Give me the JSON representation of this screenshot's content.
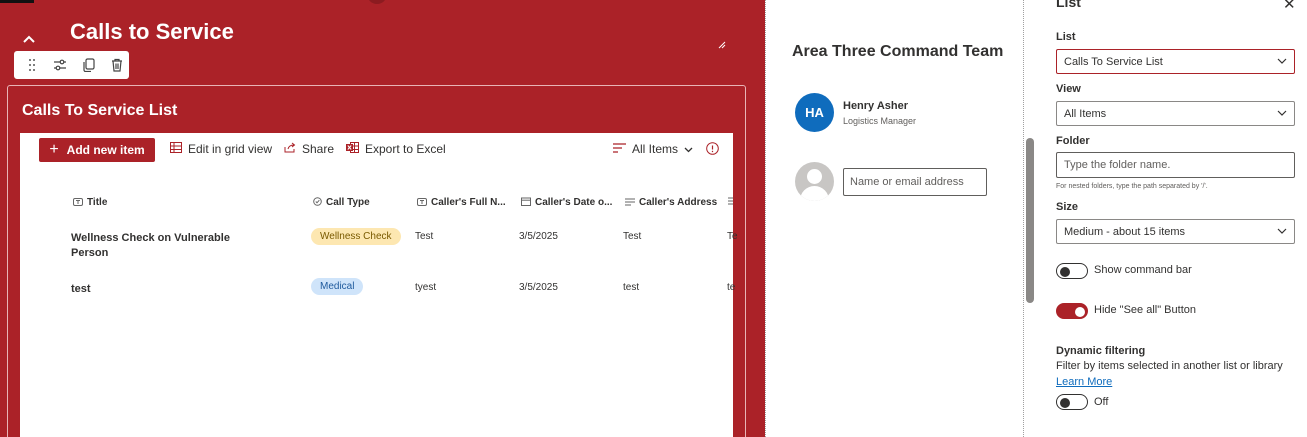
{
  "section": {
    "title": "Calls to Service",
    "collapse_icon": "chevron-up-icon",
    "resize_icon": "resize-handle-icon",
    "toolbar_icons": [
      "drag-handle-icon",
      "edit-properties-icon",
      "duplicate-icon",
      "delete-icon"
    ]
  },
  "list": {
    "title": "Calls To Service List",
    "commands": {
      "add_new": "Add new item",
      "grid_view": "Edit in grid view",
      "share": "Share",
      "export": "Export to Excel",
      "view": "All Items"
    },
    "columns": [
      "Title",
      "Call Type",
      "Caller's Full N...",
      "Caller's Date o...",
      "Caller's Address"
    ],
    "rows": [
      {
        "title": "Wellness Check on Vulnerable Person",
        "call_type": "Wellness Check",
        "full_name": "Test",
        "date": "3/5/2025",
        "address": "Test",
        "extra": "Te"
      },
      {
        "title": "test",
        "call_type": "Medical",
        "full_name": "tyest",
        "date": "3/5/2025",
        "address": "test",
        "extra": "te"
      }
    ]
  },
  "people": {
    "title": "Area Three Command Team",
    "person": {
      "initials": "HA",
      "name": "Henry Asher",
      "role": "Logistics Manager"
    },
    "add_placeholder": "Name or email address"
  },
  "panel": {
    "title": "List",
    "list_label": "List",
    "list_value": "Calls To Service List",
    "view_label": "View",
    "view_value": "All Items",
    "folder_label": "Folder",
    "folder_placeholder": "Type the folder name.",
    "folder_hint": "For nested folders, type the path separated by '/'.",
    "size_label": "Size",
    "size_value": "Medium - about 15 items",
    "show_command_bar": "Show command bar",
    "hide_see_all": "Hide \"See all\" Button",
    "dynamic_title": "Dynamic filtering",
    "dynamic_desc": "Filter by items selected in another list or library",
    "learn_more": "Learn More",
    "dynamic_state": "Off"
  },
  "colors": {
    "accent": "#ab2228",
    "link": "#0f6cbd",
    "avatar": "#0f6cbd"
  }
}
